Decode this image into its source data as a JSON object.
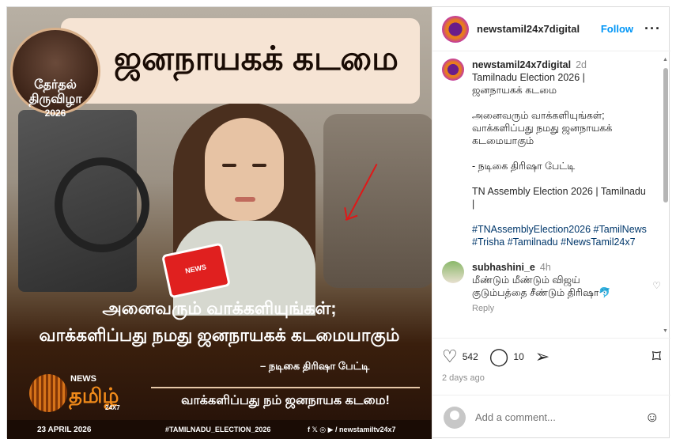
{
  "post": {
    "headline": "ஜனநாயகக் கடமை",
    "badge_line1": "தேர்தல்",
    "badge_line2": "திருவிழா",
    "badge_year": "2026",
    "mic_label": "NEWS",
    "quote_line1": "அனைவரும் வாக்களியுங்கள்;",
    "quote_line2": "வாக்களிப்பது நமது ஜனநாயகக் கடமையாகும்",
    "quote_attribution": "– நடிகை திரிஷா பேட்டி",
    "bottom_banner": "வாக்களிப்பது நம் ஜனநாயக கடமை!",
    "logo_news": "NEWS",
    "logo_name": "தமிழ்",
    "logo_sub": "24X7",
    "date": "23 APRIL 2026",
    "hashtag": "#TAMILNADU_ELECTION_2026",
    "social": "f 𝕏 ◎ ▶ / newstamiltv24x7"
  },
  "header": {
    "username": "newstamil24x7digital",
    "follow": "Follow",
    "more": "···"
  },
  "caption": {
    "username": "newstamil24x7digital",
    "time": "2d",
    "text": "Tamilnadu Election 2026 |\nஜனநாயகக் கடமை\n\nஅனைவரும் வாக்களியுங்கள்;\nவாக்களிப்பது நமது ஜனநாயகக் கடமையாகும்\n\n- நடிகை திரிஷா பேட்டி\n\nTN Assembly Election 2026 | Tamilnadu\n|",
    "tags": "#TNAssemblyElection2026 #TamilNews #Trisha #Tamilnadu #NewsTamil24x7"
  },
  "comment": {
    "username": "subhashini_e",
    "time": "4h",
    "text": "மீண்டும் மீண்டும் விஜய் குடும்பத்தை சீண்டும் திரிஷா🐬",
    "reply": "Reply"
  },
  "actions": {
    "likes": "542",
    "comments": "10",
    "ago": "2 days ago"
  },
  "add_comment": {
    "placeholder": "Add a comment..."
  },
  "colors": {
    "link": "#0095f6",
    "accent_red": "#e01818"
  }
}
